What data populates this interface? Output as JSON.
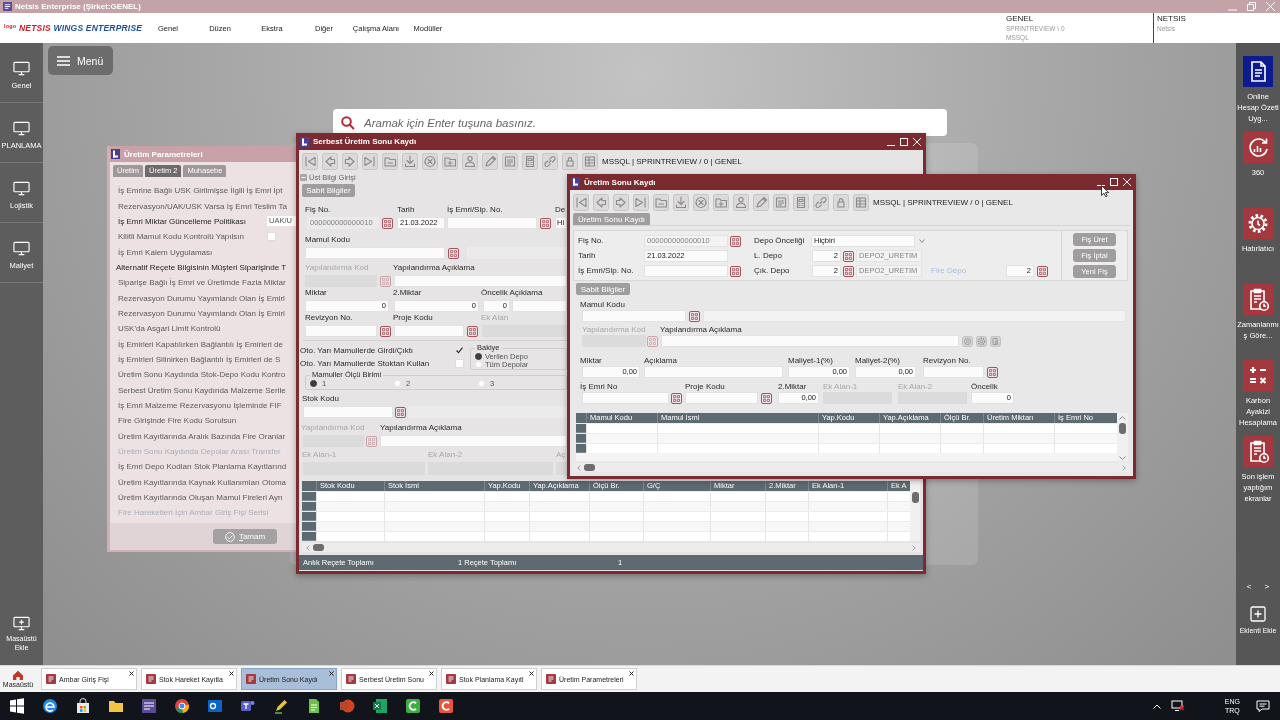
{
  "app": {
    "title": "Netsis Enterprise (Şirket:GENEL)"
  },
  "header": {
    "logo_mark": "logo",
    "brand": "NETSIS",
    "product": "WINGS ENTERPRISE",
    "menu": [
      "Genel",
      "Düzen",
      "Ekstra",
      "Diğer",
      "Çalışma Alanı",
      "Modüller"
    ],
    "company": {
      "name": "GENEL",
      "database": "SPRINTREVIEW \\ 0",
      "server": "MSSQL"
    },
    "user": {
      "name": "NETSIS",
      "subtitle": "Netsis"
    }
  },
  "left_nav": {
    "items": [
      {
        "label": "Genel"
      },
      {
        "label": "PLANLAMA"
      },
      {
        "label": "Lojistik"
      },
      {
        "label": "Maliyet"
      }
    ],
    "add_desktop": "Masaüstü Ekle"
  },
  "desktop": {
    "menu_button": "Menü",
    "search": {
      "placeholder": "Aramak için Enter tuşuna basınız."
    }
  },
  "parameters_window": {
    "title": "Üretim Parametreleri",
    "tabs": [
      {
        "label": "Üretim",
        "selected": false
      },
      {
        "label": "Üretim 2",
        "selected": true
      },
      {
        "label": "Muhasebe",
        "selected": false
      }
    ],
    "rows": [
      {
        "kind": "text",
        "label": "İş Emrine Bağlı USK Girilmişse İlgili İş Emri İpt",
        "disabled": false
      },
      {
        "kind": "text",
        "label": "Rezervasyon/UAK/USK Varsa İş Emri Teslim Ta",
        "disabled": false
      },
      {
        "kind": "select",
        "label": "İş Emri Miktar Güncelleme Politikası",
        "value": "UAK/U",
        "disabled": false
      },
      {
        "kind": "checkbox",
        "label": "Kilitli Mamul Kodu Kontrolü Yapılsın",
        "checked": false,
        "disabled": false
      },
      {
        "kind": "text",
        "label": "İş Emri Kalem Uygulaması",
        "disabled": false
      },
      {
        "kind": "section",
        "label": "Alternatif Reçete Bilgisinin Müşteri Siparişinde T",
        "disabled": false
      },
      {
        "kind": "text",
        "label": "Siparişe Bağlı İş Emri ve Üretimde Fazla Miktar",
        "disabled": false
      },
      {
        "kind": "text",
        "label": "Rezervasyon Durumu Yayımlandı Olan İş Emirl",
        "disabled": false
      },
      {
        "kind": "text",
        "label": "Rezervasyon Durumu Yayımlandı Olan İş Emirl",
        "disabled": false
      },
      {
        "kind": "text",
        "label": "USK'da Asgari Limit Kontrolü",
        "disabled": false
      },
      {
        "kind": "text",
        "label": "İş Emirleri Kapatılırken Bağlantılı İş Emirleri de",
        "disabled": false
      },
      {
        "kind": "text",
        "label": "İş Emirleri Silinirken Bağlantılı İş Emirleri de S",
        "disabled": false
      },
      {
        "kind": "text",
        "label": "Üretim Sonu Kaydında Stok-Depo Kodu Kontro",
        "disabled": false
      },
      {
        "kind": "text",
        "label": "Serbest Üretim Sonu Kaydında Malzeme Serile",
        "disabled": false
      },
      {
        "kind": "text",
        "label": "İş Emri Malzeme Rezervasyonu İşleminde FIF",
        "disabled": false
      },
      {
        "kind": "text",
        "label": "Fire Girişinde Fire Kodu Sorulsun",
        "disabled": false
      },
      {
        "kind": "text",
        "label": "Üretim Kayıtlarında Aralık Bazında Fire Oranlar",
        "disabled": false
      },
      {
        "kind": "text",
        "label": "Üretim Sonu Kaydında Depolar Arası Transfer",
        "disabled": true
      },
      {
        "kind": "text",
        "label": "İş Emri Depo Kodları Stok Planlama Kayıtlarınd",
        "disabled": false
      },
      {
        "kind": "text",
        "label": "Üretim Kayıtlarında Kaynak Kullanımları Otoma",
        "disabled": false
      },
      {
        "kind": "text",
        "label": "Üretim Kayıtlarında Oluşan Mamul Fireleri Ayrı",
        "disabled": false
      },
      {
        "kind": "text",
        "label": "Fire Hareketleri İçin Ambar Giriş Fişi Serisi",
        "disabled": true
      }
    ],
    "ok_button": "Tamam"
  },
  "free_production_window": {
    "title": "Serbest Üretim Sonu Kaydı",
    "connection": "MSSQL | SPRINTREVIEW / 0 | GENEL",
    "header_toggle": "Üst Bilgi Girişi",
    "section_tab": "Sabit Bilgiler",
    "fis_no": {
      "label": "Fiş No.",
      "value": "000000000000010",
      "read_only": true
    },
    "date": {
      "label": "Tarih",
      "value": "21.03.2022"
    },
    "order_no": {
      "label": "İş Emri/Sip. No."
    },
    "warehouse": {
      "label": "De",
      "value": "Hi"
    },
    "product_code": {
      "label": "Mamul Kodu"
    },
    "config_code": {
      "label": "Yapılandırma Kod",
      "disabled": true
    },
    "config_desc": {
      "label": "Yapılandırma Açıklama"
    },
    "quantity": {
      "label": "Miktar",
      "value": "0"
    },
    "quantity2": {
      "label": "2.Miktar",
      "value": "0"
    },
    "priority": {
      "label": "Öncelik Açıklama",
      "value": "0"
    },
    "revision": {
      "label": "Revizyon No."
    },
    "project_code": {
      "label": "Proje Kodu"
    },
    "extra": {
      "label": "Ek Alan",
      "disabled": true
    },
    "options": [
      {
        "label": "Oto. Yarı Mamullerde Girdi/Çıktı",
        "checked": true
      },
      {
        "label": "Oto. Yarı Mamullerde Stoktan Kullan",
        "checked": false
      }
    ],
    "balance": {
      "title": "Bakiye",
      "options": [
        {
          "label": "Verilen Depo",
          "selected": true
        },
        {
          "label": "Tüm Depolar",
          "selected": false
        }
      ]
    },
    "unit": {
      "title": "Mamuller Ölçü Birimi",
      "options": [
        {
          "label": "1",
          "selected": true
        },
        {
          "label": "2",
          "selected": false
        },
        {
          "label": "3",
          "selected": false
        }
      ]
    },
    "stock_code": {
      "label": "Stok Kodu"
    },
    "stock_config_code": {
      "label": "Yapılandırma Kod",
      "disabled": true
    },
    "stock_config_desc": {
      "label": "Yapılandırma Açıklama"
    },
    "extra_fields": [
      {
        "label": "Ek Alan-1",
        "disabled": true
      },
      {
        "label": "Ek Alan-2",
        "disabled": true
      },
      {
        "label": "Aç",
        "disabled": true
      }
    ],
    "table": {
      "columns": [
        "Stok Kodu",
        "Stok İsmi",
        "Yap.Kodu",
        "Yap.Açıklama",
        "Ölçü Br.",
        "G/Ç",
        "Miktar",
        "2.Miktar",
        "Ek Alan-1",
        "Ek A"
      ]
    },
    "status_bar": [
      "Anlık Reçete Toplamı",
      "1 Reçete Toplamı",
      "1"
    ]
  },
  "production_window": {
    "title": "Üretim Sonu Kaydı",
    "connection": "MSSQL | SPRINTREVIEW / 0 | GENEL",
    "header_tab": "Üretim Sonu Kaydı",
    "fis_no": {
      "label": "Fiş No.",
      "value": "000000000000010",
      "read_only": true
    },
    "date": {
      "label": "Tarih",
      "value": "21.03.2022"
    },
    "order_no": {
      "label": "İş Emri/Sip. No."
    },
    "warehouse_priority": {
      "label": "Depo Önceliği",
      "value": "Hiçbiri"
    },
    "input_warehouse": {
      "label": "L. Depo",
      "value": "2",
      "warehouse_name": "DEPO2_URETIM"
    },
    "output_warehouse": {
      "label": "Çık. Depo",
      "value": "2",
      "warehouse_name": "DEPO2_URETIM"
    },
    "scrap_warehouse": {
      "label": "Fire Depo",
      "value": "2",
      "dimmed": true
    },
    "actions": [
      "Fiş Üret",
      "Fiş İptal",
      "Yeni Fiş"
    ],
    "section_tab": "Sabit Bilgiler",
    "product_code": {
      "label": "Mamul Kodu"
    },
    "config_code": {
      "label": "Yapılandırma Kod",
      "disabled": true
    },
    "config_desc": {
      "label": "Yapılandırma Açıklama"
    },
    "quantity": {
      "label": "Miktar",
      "value": "0,00"
    },
    "description": {
      "label": "Açıklama"
    },
    "cost1": {
      "label": "Maliyet-1(%)",
      "value": "0,00"
    },
    "cost2": {
      "label": "Maliyet-2(%)",
      "value": "0,00"
    },
    "revision": {
      "label": "Revizyon No."
    },
    "work_order": {
      "label": "İş Emri No"
    },
    "project_code": {
      "label": "Proje Kodu"
    },
    "quantity2": {
      "label": "2.Miktar",
      "value": "0,00"
    },
    "extra1": {
      "label": "Ek Alan-1",
      "disabled": true
    },
    "extra2": {
      "label": "Ek Alan-2",
      "disabled": true
    },
    "priority": {
      "label": "Öncelik",
      "value": "0"
    },
    "table": {
      "columns": [
        "Mamul Kodu",
        "Mamul İsmi",
        "Yap.Kodu",
        "Yap.Açıklama",
        "Ölçü Br.",
        "Üretim Miktarı",
        "İş Emri No"
      ]
    }
  },
  "right_panel": {
    "items": [
      {
        "label": "Online Hesap Özeti Uyg...",
        "kind": "document",
        "color": "#0c1b8e"
      },
      {
        "label": "360",
        "kind": "chart",
        "color": "#a3393f"
      },
      {
        "label": "Hatırlatıcı",
        "kind": "gear",
        "color": "#a3393f"
      },
      {
        "label": "Zamanlanmış Göre...",
        "kind": "clipboard",
        "color": "#a3393f"
      },
      {
        "label": "Karbon Ayakizi Hesaplama",
        "kind": "calculator",
        "color": "#a3393f"
      },
      {
        "label": "Son işlem yaptığım ekranlar",
        "kind": "clipboard",
        "color": "#a3393f"
      }
    ],
    "pager": [
      "<",
      ">"
    ],
    "add_plugin": "Eklenti Ekle"
  },
  "tab_bar": {
    "home": "Masaüstü",
    "tabs": [
      {
        "label": "Ambar Giriş Fişi",
        "selected": false
      },
      {
        "label": "Stok Hareket Kayıtla",
        "selected": false
      },
      {
        "label": "Üretim Sonu Kaydı",
        "selected": true
      },
      {
        "label": "Serbest Üretim Sonu",
        "selected": false
      },
      {
        "label": "Stok Planlama Kayıtl",
        "selected": false
      },
      {
        "label": "Üretim Parametreleri",
        "selected": false
      }
    ]
  },
  "taskbar": {
    "language": "ENG",
    "layout": "TRQ"
  }
}
